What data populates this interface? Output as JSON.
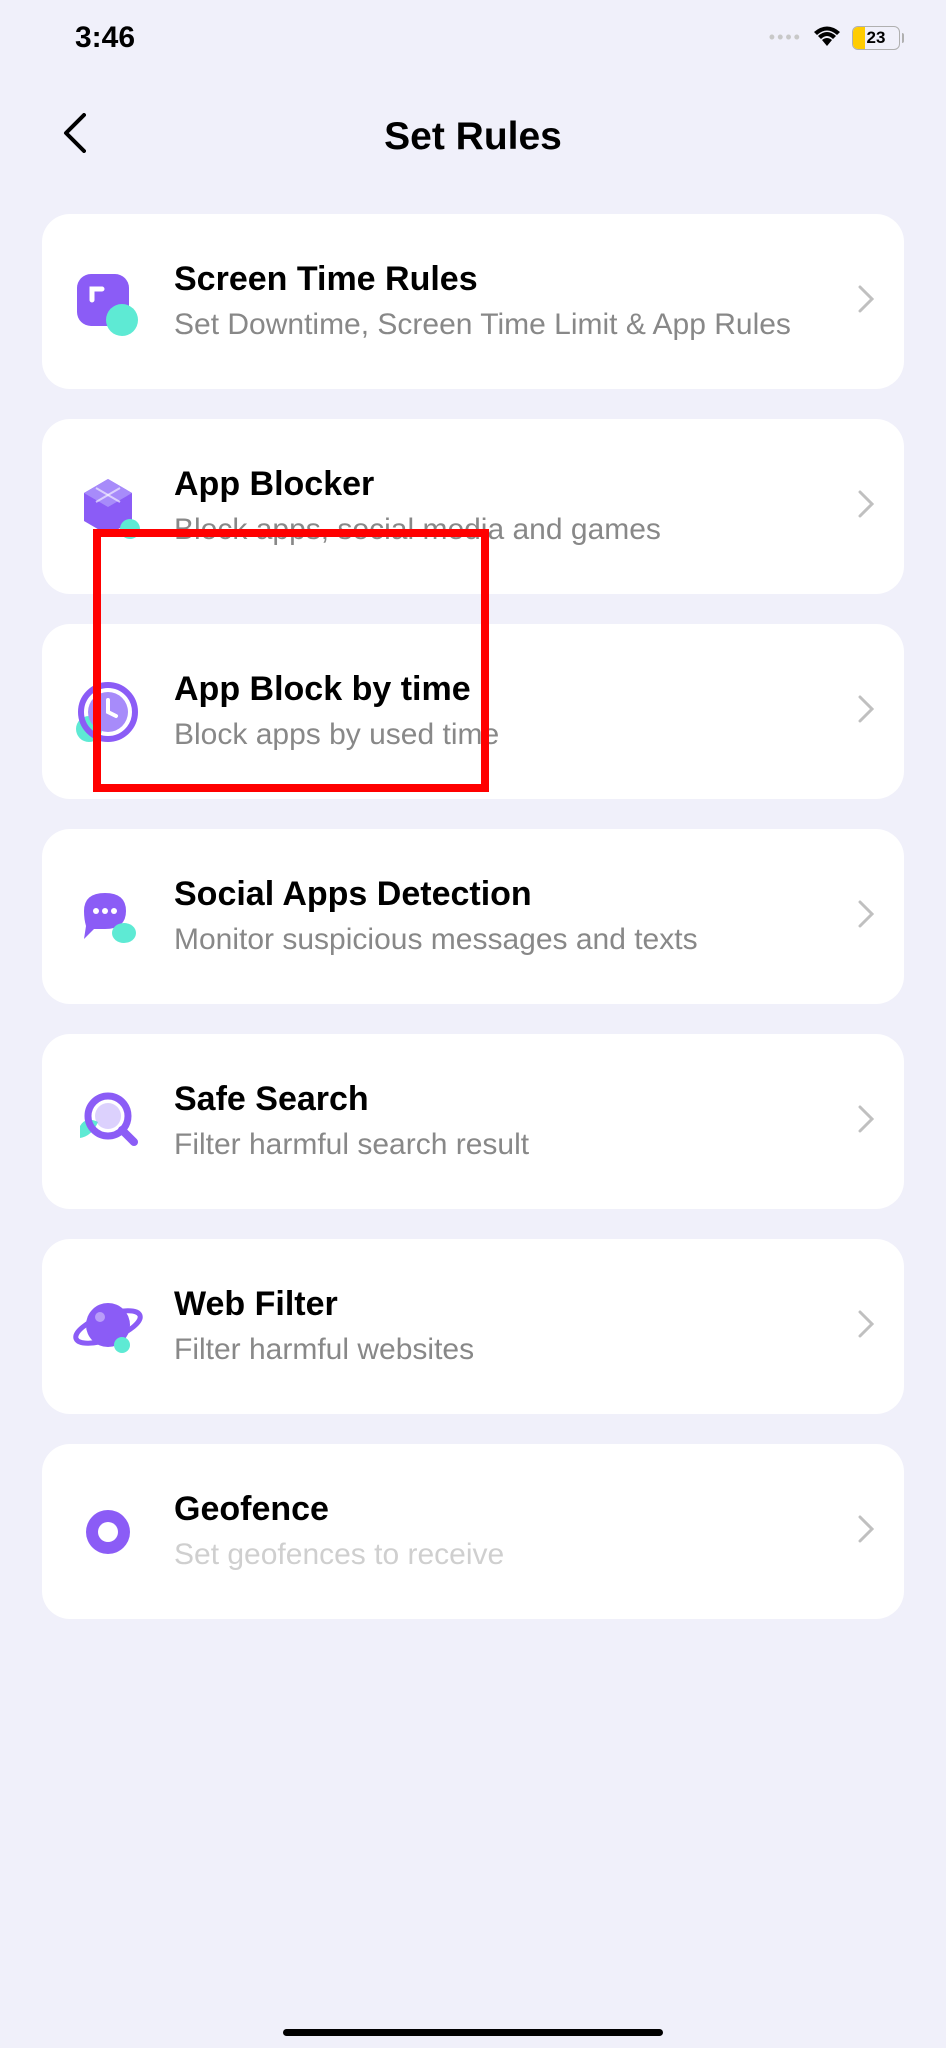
{
  "status": {
    "time": "3:46",
    "battery": "23"
  },
  "header": {
    "title": "Set Rules"
  },
  "items": [
    {
      "id": "screen-time",
      "title": "Screen Time Rules",
      "desc": "Set Downtime, Screen Time Limit & App Rules"
    },
    {
      "id": "app-blocker",
      "title": "App Blocker",
      "desc": "Block apps, social media and games"
    },
    {
      "id": "app-block-time",
      "title": "App Block by time",
      "desc": "Block apps by used time"
    },
    {
      "id": "social-detection",
      "title": "Social Apps Detection",
      "desc": "Monitor suspicious messages and texts"
    },
    {
      "id": "safe-search",
      "title": "Safe Search",
      "desc": "Filter harmful search result"
    },
    {
      "id": "web-filter",
      "title": "Web Filter",
      "desc": "Filter harmful websites"
    },
    {
      "id": "geofence",
      "title": "Geofence",
      "desc": "Set geofences to receive"
    }
  ]
}
